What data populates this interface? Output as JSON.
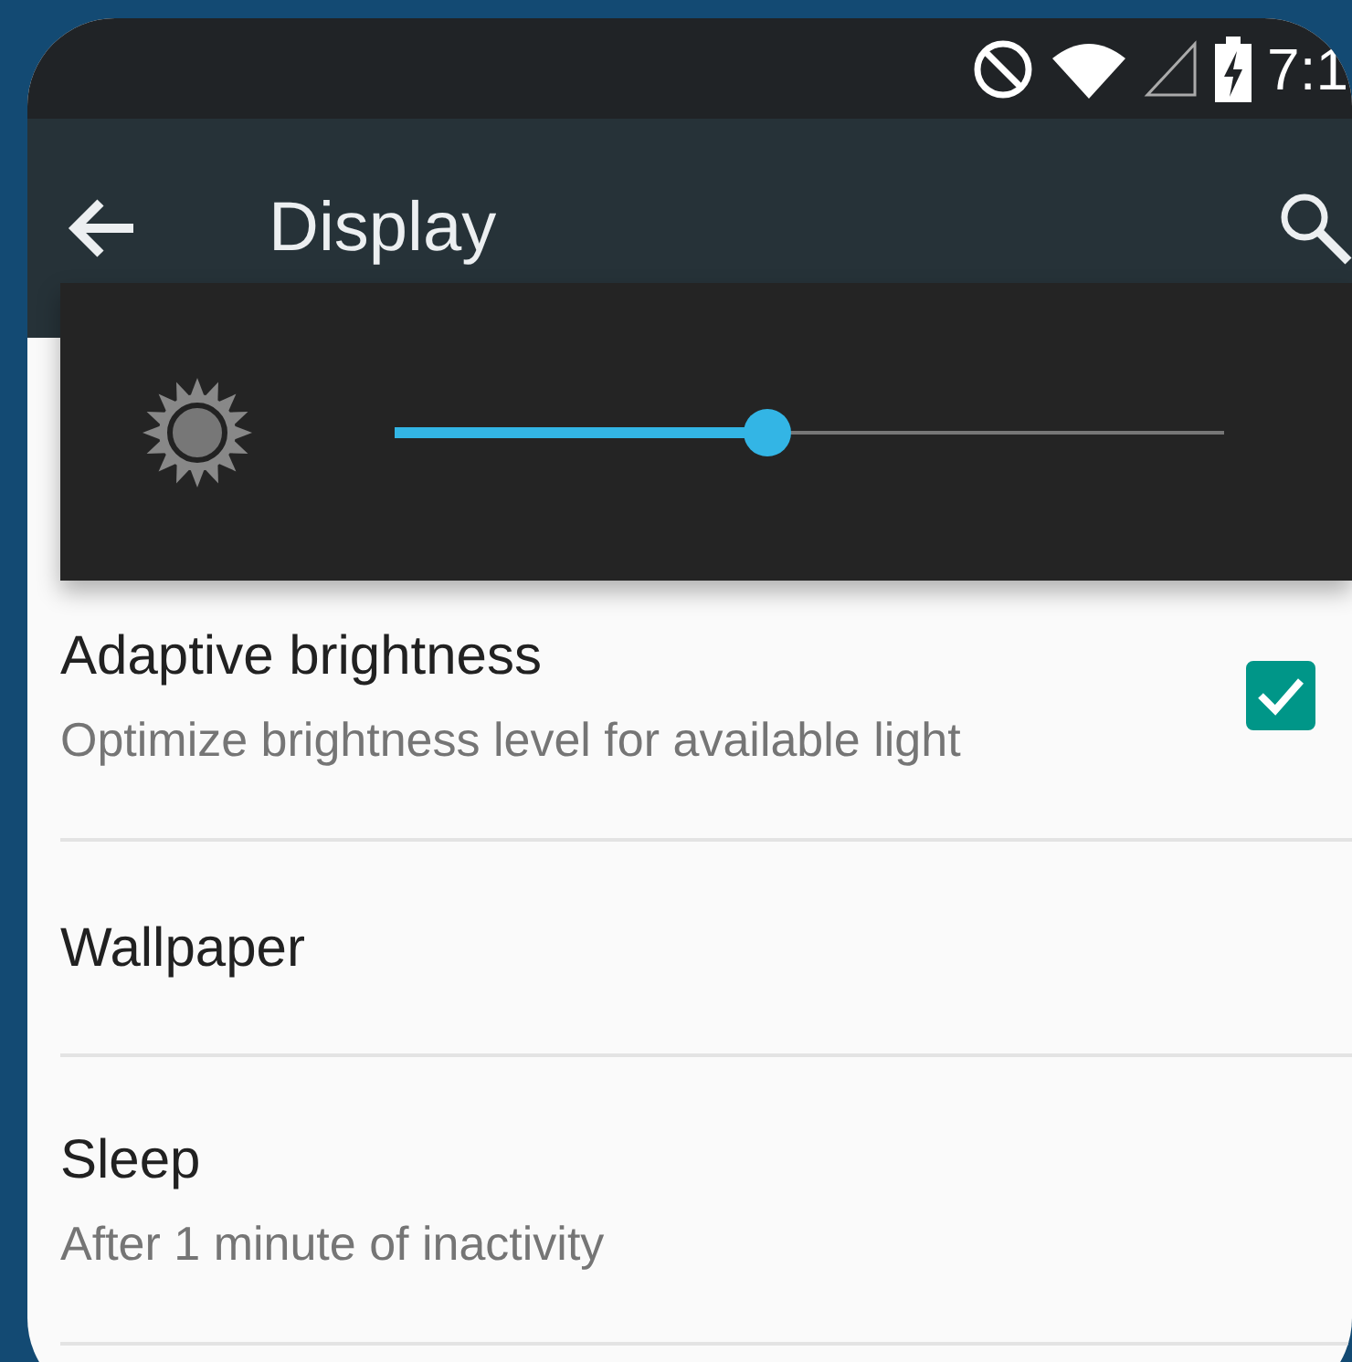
{
  "status_bar": {
    "time": "7:1"
  },
  "toolbar": {
    "title": "Display"
  },
  "brightness_dialog": {
    "level": 0.45
  },
  "settings": [
    {
      "kind": "checkbox",
      "title": "Adaptive brightness",
      "summary": "Optimize brightness level for available light",
      "checked": true
    },
    {
      "kind": "plain",
      "title": "Wallpaper"
    },
    {
      "kind": "plain",
      "title": "Sleep",
      "summary": "After 1 minute of inactivity"
    }
  ]
}
